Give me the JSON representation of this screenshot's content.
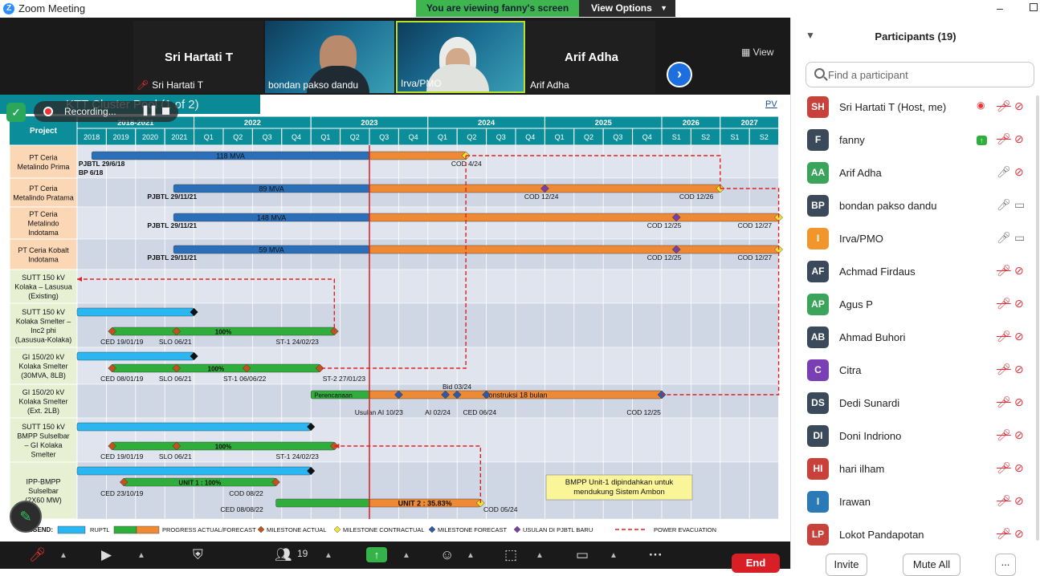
{
  "window": {
    "title": "Zoom Meeting",
    "logo_letter": "Z"
  },
  "banner": {
    "viewing_text": "You are viewing fanny's screen",
    "view_options_label": "View Options"
  },
  "video_strip": {
    "tiles": [
      {
        "name": "Sri Hartati T",
        "label": "Sri Hartati T"
      },
      {
        "label": "bondan pakso dandu"
      },
      {
        "label": "Irva/PMO"
      },
      {
        "name": "Arif Adha",
        "label": "Arif Adha"
      }
    ],
    "view_label": "View"
  },
  "recording": {
    "status": "Recording..."
  },
  "slide": {
    "title": "KTT Cluster Pool  (1 of 2)",
    "pv_label": "PV"
  },
  "chart_data": {
    "type": "gantt",
    "corner_header": "Project",
    "years": [
      {
        "label": "2018-2021",
        "span": 4
      },
      {
        "label": "2022",
        "span": 4
      },
      {
        "label": "2023",
        "span": 4
      },
      {
        "label": "2024",
        "span": 4
      },
      {
        "label": "2025",
        "span": 4
      },
      {
        "label": "2026",
        "span": 2
      },
      {
        "label": "2027",
        "span": 2
      }
    ],
    "periods": [
      "2018",
      "2019",
      "2020",
      "2021",
      "Q1",
      "Q2",
      "Q3",
      "Q4",
      "Q1",
      "Q2",
      "Q3",
      "Q4",
      "Q1",
      "Q2",
      "Q3",
      "Q4",
      "Q1",
      "Q2",
      "Q3",
      "Q4",
      "S1",
      "S2",
      "S1",
      "S2"
    ],
    "today_marker": "Q3 2023",
    "rows": [
      {
        "label": "PT Ceria\nMetalindo Prima",
        "color": "#fcd7b6"
      },
      {
        "label": "PT Ceria\nMetalindo Pratama",
        "color": "#fcd7b6"
      },
      {
        "label": "PT Ceria\nMetalindo\nIndotama",
        "color": "#fcd7b6"
      },
      {
        "label": "PT Ceria Kobalt\nIndotama",
        "color": "#fcd7b6"
      },
      {
        "label": "SUTT 150 kV\nKolaka – Lasusua\n(Existing)",
        "color": "#e8f0d4"
      },
      {
        "label": "SUTT 150 kV\nKolaka Smelter –\nInc2 phi\n(Lasusua-Kolaka)",
        "color": "#e8f0d4"
      },
      {
        "label": "GI 150/20 kV\nKolaka Smelter\n(30MVA, 8LB)",
        "color": "#e8f0d4"
      },
      {
        "label": "GI 150/20 kV\nKolaka Smelter\n(Ext. 2LB)",
        "color": "#e8f0d4"
      },
      {
        "label": "SUTT 150 kV\nBMPP  Sulselbar\n– GI Kolaka\nSmelter",
        "color": "#e8f0d4"
      },
      {
        "label": "IPP-BMPP\nSulselbar\n(2X60 MW)",
        "color": "#e8f0d4"
      }
    ],
    "bars": [
      {
        "row": 0,
        "kind": "actual",
        "start": 0.5,
        "end": 10.0,
        "text": "118 MVA"
      },
      {
        "row": 0,
        "kind": "forecast",
        "start": 10.0,
        "end": 13.3,
        "text": ""
      },
      {
        "row": 1,
        "kind": "actual",
        "start": 3.3,
        "end": 10.0,
        "text": "89 MVA"
      },
      {
        "row": 1,
        "kind": "forecast",
        "start": 10.0,
        "end": 22.0,
        "text": ""
      },
      {
        "row": 2,
        "kind": "actual",
        "start": 3.3,
        "end": 10.0,
        "text": "148 MVA"
      },
      {
        "row": 2,
        "kind": "forecast",
        "start": 10.0,
        "end": 24.0,
        "text": ""
      },
      {
        "row": 3,
        "kind": "actual",
        "start": 3.3,
        "end": 10.0,
        "text": "59 MVA"
      },
      {
        "row": 3,
        "kind": "forecast",
        "start": 10.0,
        "end": 24.0,
        "text": ""
      },
      {
        "row": 5,
        "kind": "ruptl",
        "start": 0.0,
        "end": 4.0,
        "text": ""
      },
      {
        "row": 5,
        "kind": "progress",
        "start": 1.2,
        "end": 8.8,
        "text": "100%"
      },
      {
        "row": 6,
        "kind": "ruptl",
        "start": 0.0,
        "end": 4.0,
        "text": ""
      },
      {
        "row": 6,
        "kind": "progress",
        "start": 1.2,
        "end": 8.3,
        "text": "100%"
      },
      {
        "row": 7,
        "kind": "progress",
        "start": 8.0,
        "end": 10.0,
        "text": "Perencanaan"
      },
      {
        "row": 7,
        "kind": "forecast",
        "start": 10.0,
        "end": 20.0,
        "text": "Konstruksi 18 bulan"
      },
      {
        "row": 8,
        "kind": "ruptl",
        "start": 0.0,
        "end": 8.0,
        "text": ""
      },
      {
        "row": 8,
        "kind": "progress",
        "start": 1.2,
        "end": 8.8,
        "text": "100%"
      },
      {
        "row": 9,
        "kind": "ruptl",
        "start": 0.0,
        "end": 8.0,
        "text": ""
      },
      {
        "row": 9,
        "kind": "progress",
        "start": 1.6,
        "end": 6.8,
        "text": "UNIT 1 : 100%"
      },
      {
        "row": 9,
        "kind": "progress",
        "start": 6.8,
        "end": 10.0,
        "text": ""
      },
      {
        "row": 9,
        "kind": "forecast",
        "start": 10.0,
        "end": 13.8,
        "text": "UNIT 2 : 35.83%"
      }
    ],
    "milestones": [
      {
        "row": 0,
        "type": "contractual",
        "at": 13.3
      },
      {
        "row": 1,
        "type": "baru",
        "at": 16.0
      },
      {
        "row": 1,
        "type": "contractual",
        "at": 22.0
      },
      {
        "row": 2,
        "type": "baru",
        "at": 20.5
      },
      {
        "row": 2,
        "type": "contractual",
        "at": 24.0
      },
      {
        "row": 3,
        "type": "baru",
        "at": 20.5
      },
      {
        "row": 3,
        "type": "contractual",
        "at": 24.0
      },
      {
        "row": 5,
        "type": "actual",
        "at": 1.2
      },
      {
        "row": 5,
        "type": "actual",
        "at": 3.4
      },
      {
        "row": 5,
        "type": "actual",
        "at": 8.8
      },
      {
        "row": 6,
        "type": "actual",
        "at": 1.2
      },
      {
        "row": 6,
        "type": "actual",
        "at": 3.4
      },
      {
        "row": 6,
        "type": "actual",
        "at": 5.8
      },
      {
        "row": 6,
        "type": "actual",
        "at": 8.3
      },
      {
        "row": 7,
        "type": "forecast",
        "at": 11.0
      },
      {
        "row": 7,
        "type": "forecast",
        "at": 12.6
      },
      {
        "row": 7,
        "type": "forecast",
        "at": 13.0
      },
      {
        "row": 7,
        "type": "forecast",
        "at": 14.0
      },
      {
        "row": 7,
        "type": "forecast",
        "at": 20.0
      },
      {
        "row": 8,
        "type": "actual",
        "at": 1.2
      },
      {
        "row": 8,
        "type": "actual",
        "at": 3.4
      },
      {
        "row": 8,
        "type": "actual",
        "at": 8.8
      },
      {
        "row": 9,
        "type": "actual",
        "at": 1.6
      },
      {
        "row": 9,
        "type": "actual",
        "at": 6.8
      },
      {
        "row": 9,
        "type": "actual",
        "at": 6.8
      },
      {
        "row": 9,
        "type": "contractual",
        "at": 13.8
      }
    ],
    "labels": [
      {
        "row": 0,
        "at": 0.05,
        "line": 1,
        "text": "PJBTL 29/6/18"
      },
      {
        "row": 0,
        "at": 0.05,
        "line": 2,
        "text": "BP 6/18"
      },
      {
        "row": 0,
        "at": 12.8,
        "line": 1,
        "text": "COD 4/24"
      },
      {
        "row": 1,
        "at": 2.4,
        "line": 1,
        "text": "PJBTL 29/11/21"
      },
      {
        "row": 1,
        "at": 15.3,
        "line": 1,
        "text": "COD 12/24"
      },
      {
        "row": 1,
        "at": 20.6,
        "line": 1,
        "text": "COD 12/26"
      },
      {
        "row": 2,
        "at": 2.4,
        "line": 1,
        "text": "PJBTL 29/11/21"
      },
      {
        "row": 2,
        "at": 19.5,
        "line": 1,
        "text": "COD 12/25"
      },
      {
        "row": 2,
        "at": 22.6,
        "line": 1,
        "text": "COD 12/27"
      },
      {
        "row": 3,
        "at": 2.4,
        "line": 1,
        "text": "PJBTL 29/11/21"
      },
      {
        "row": 3,
        "at": 19.5,
        "line": 1,
        "text": "COD 12/25"
      },
      {
        "row": 3,
        "at": 22.6,
        "line": 1,
        "text": "COD 12/27"
      },
      {
        "row": 5,
        "at": 0.8,
        "line": 1,
        "text": "CED 19/01/19"
      },
      {
        "row": 5,
        "at": 2.8,
        "line": 1,
        "text": "SLO 06/21"
      },
      {
        "row": 5,
        "at": 6.8,
        "line": 1,
        "text": "ST-1 24/02/23"
      },
      {
        "row": 6,
        "at": 0.8,
        "line": 1,
        "text": "CED 08/01/19"
      },
      {
        "row": 6,
        "at": 2.8,
        "line": 1,
        "text": "SLO 06/21"
      },
      {
        "row": 6,
        "at": 5.0,
        "line": 1,
        "text": "ST-1 06/06/22"
      },
      {
        "row": 6,
        "at": 8.4,
        "line": 1,
        "text": "ST-2 27/01/23"
      },
      {
        "row": 7,
        "at": 12.5,
        "line": 0,
        "text": "Bid 03/24"
      },
      {
        "row": 7,
        "at": 9.5,
        "line": 1,
        "text": "Usulan AI 10/23"
      },
      {
        "row": 7,
        "at": 11.9,
        "line": 1,
        "text": "AI 02/24"
      },
      {
        "row": 7,
        "at": 13.2,
        "line": 1,
        "text": "CED 06/24"
      },
      {
        "row": 7,
        "at": 18.8,
        "line": 1,
        "text": "COD 12/25"
      },
      {
        "row": 8,
        "at": 0.8,
        "line": 1,
        "text": "CED 19/01/19"
      },
      {
        "row": 8,
        "at": 2.8,
        "line": 1,
        "text": "SLO 06/21"
      },
      {
        "row": 8,
        "at": 6.8,
        "line": 1,
        "text": "ST-1 24/02/23"
      },
      {
        "row": 9,
        "at": 0.8,
        "line": 1,
        "text": "CED 23/10/19"
      },
      {
        "row": 9,
        "at": 5.2,
        "line": 1,
        "text": "COD 08/22"
      },
      {
        "row": 9,
        "at": 4.9,
        "line": 2,
        "text": "CED 08/08/22"
      },
      {
        "row": 9,
        "at": 13.9,
        "line": 2,
        "text": "COD 05/24"
      }
    ],
    "note": "BMPP Unit-1 dipindahkan untuk\nmendukung Sistem Ambon",
    "legend": {
      "title": "LEGEND:",
      "items": [
        "RUPTL",
        "PROGRESS ACTUAL/FORECAST",
        "MILESTONE ACTUAL",
        "MILESTONE CONTRACTUAL",
        "MILESTONE FORECAST",
        "USULAN DI PJBTL BARU",
        "POWER EVACUATION"
      ]
    },
    "colors": {
      "actual": "#2a6fb8",
      "forecast": "#ee8a35",
      "progress": "#2fae3c",
      "ruptl": "#2ab6f0",
      "contractual": "#f2e233",
      "baru": "#7a3fa0",
      "milestone_actual": "#c0541f",
      "milestone_forecast": "#2f5aa8",
      "evacuation": "#e02020",
      "today": "#d62020"
    }
  },
  "toolbar": {
    "participants_count": "19",
    "end_label": "End"
  },
  "panel": {
    "title": "Participants (19)",
    "search_placeholder": "Find a participant",
    "participants": [
      {
        "initials": "SH",
        "name": "Sri Hartati T (Host, me)",
        "color": "#c8413a",
        "mic": "muted",
        "cam": "off",
        "extra": "rec"
      },
      {
        "initials": "F",
        "name": "fanny",
        "color": "#3b4a5a",
        "mic": "muted",
        "cam": "off",
        "extra": "share"
      },
      {
        "initials": "AA",
        "name": "Arif Adha",
        "color": "#3aa45a",
        "mic": "on",
        "cam": "off"
      },
      {
        "initials": "BP",
        "name": "bondan pakso dandu",
        "color": "#3b4a5a",
        "mic": "on",
        "cam": "on"
      },
      {
        "initials": "I",
        "name": "Irva/PMO",
        "color": "#f0962a",
        "mic": "on",
        "cam": "on"
      },
      {
        "initials": "AF",
        "name": "Achmad Firdaus",
        "color": "#3b4a5a",
        "mic": "muted",
        "cam": "off"
      },
      {
        "initials": "AP",
        "name": "Agus P",
        "color": "#3aa45a",
        "mic": "muted",
        "cam": "off"
      },
      {
        "initials": "AB",
        "name": "Ahmad Buhori",
        "color": "#3b4a5a",
        "mic": "muted",
        "cam": "off"
      },
      {
        "initials": "C",
        "name": "Citra",
        "color": "#7b3fb5",
        "mic": "muted",
        "cam": "off"
      },
      {
        "initials": "DS",
        "name": "Dedi Sunardi",
        "color": "#3b4a5a",
        "mic": "muted",
        "cam": "off"
      },
      {
        "initials": "DI",
        "name": "Doni Indriono",
        "color": "#3b4a5a",
        "mic": "muted",
        "cam": "off"
      },
      {
        "initials": "HI",
        "name": "hari ilham",
        "color": "#c8413a",
        "mic": "muted",
        "cam": "off"
      },
      {
        "initials": "I",
        "name": "Irawan",
        "color": "#2a7ab8",
        "mic": "muted",
        "cam": "off"
      },
      {
        "initials": "LP",
        "name": "Lokot Pandapotan",
        "color": "#c8413a",
        "mic": "muted",
        "cam": "off"
      }
    ],
    "invite_label": "Invite",
    "mute_all_label": "Mute All",
    "more_label": "..."
  }
}
